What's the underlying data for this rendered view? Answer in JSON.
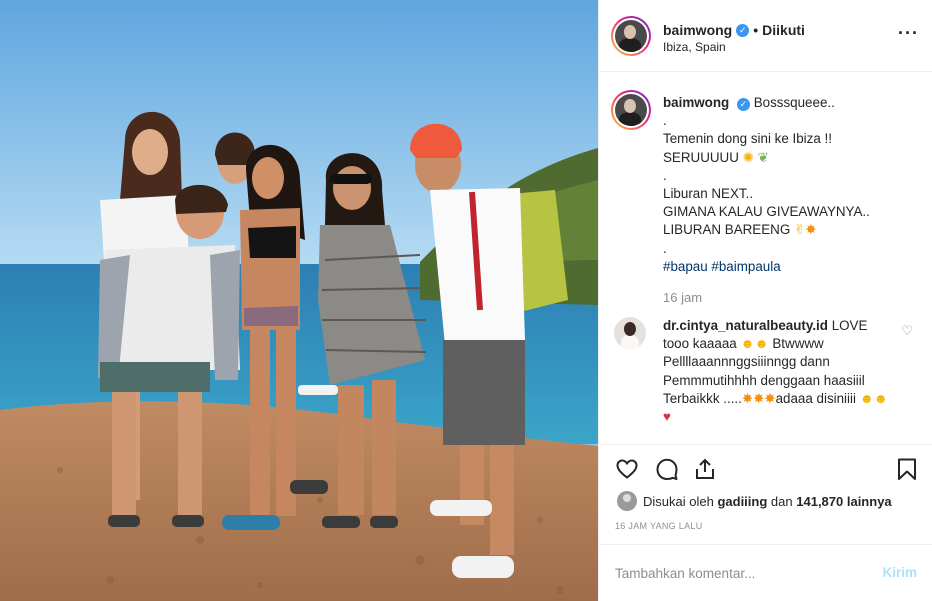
{
  "post": {
    "username": "baimwong",
    "follow_status": "Diikuti",
    "location": "Ibiza, Spain",
    "more_icon": "more-horizontal-icon"
  },
  "caption": {
    "username": "baimwong",
    "lines": [
      "Bosssqueee..",
      ".",
      "Temenin dong sini ke Ibiza !!",
      "SERUUUUU",
      ".",
      "Liburan NEXT..",
      "GIMANA KALAU GIVEAWAYNYA..",
      "LIBURAN BAREENG",
      "."
    ],
    "hashtags": "#bapau #baimpaula",
    "time": "16 jam"
  },
  "comment": {
    "username": "dr.cintya_naturalbeauty.id",
    "text_1": "LOVE tooo kaaaaa",
    "text_2": "Btwwww Pellllaaannnggsiiinngg dann Pemmmutihhhh denggaan haasiiil Terbaikkk .....",
    "text_3": "adaaa disiniiii"
  },
  "likes": {
    "prefix": "Disukai oleh",
    "user": "gadiiing",
    "middle": "dan",
    "count": "141,870 lainnya"
  },
  "timestamp": "16 JAM YANG LALU",
  "add_comment": {
    "placeholder": "Tambahkan komentar...",
    "post_label": "Kirim"
  },
  "icons": {
    "like": "heart-icon",
    "comment": "comment-icon",
    "share": "share-icon",
    "save": "bookmark-icon"
  },
  "colors": {
    "verified": "#3897f0",
    "hashtag": "#003569",
    "muted": "#8e8e8e",
    "post_button_disabled": "#b2dffc"
  }
}
